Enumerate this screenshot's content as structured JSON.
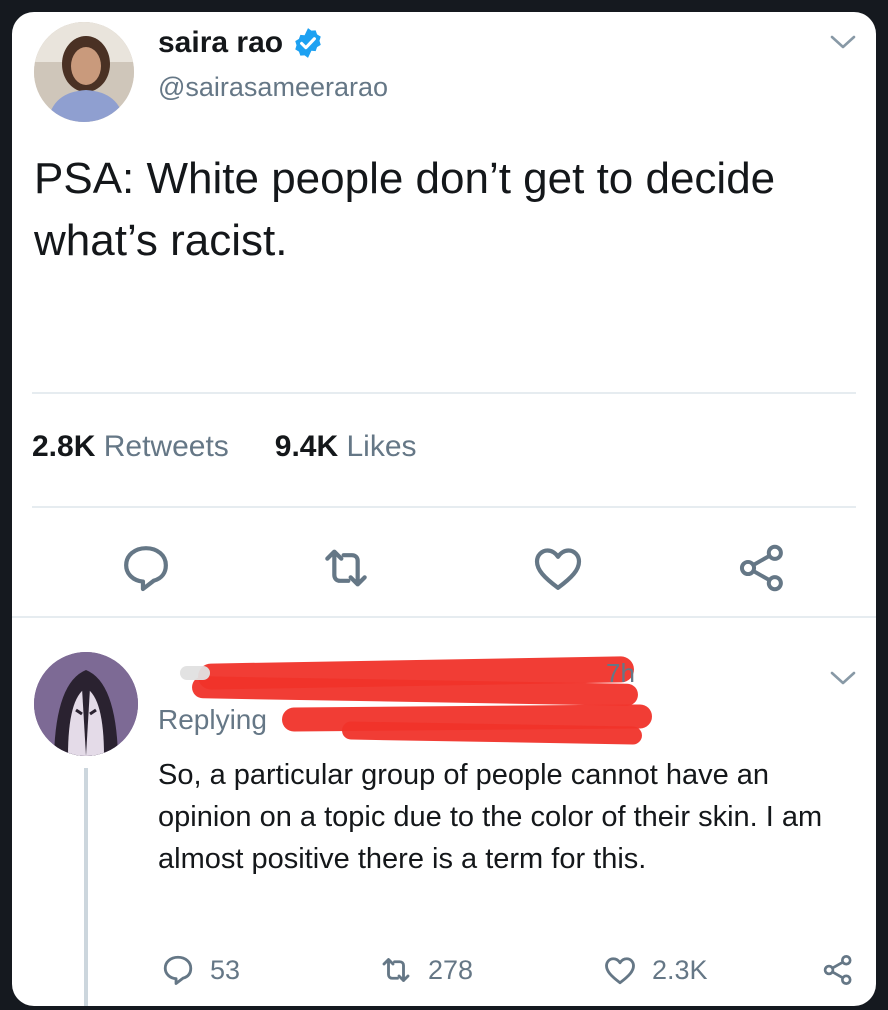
{
  "tweet": {
    "author_name": "saira rao",
    "author_handle": "@sairasameerarao",
    "text": "PSA: White people don’t get to decide what’s racist.",
    "retweets_count": "2.8K",
    "retweets_label": "Retweets",
    "likes_count": "9.4K",
    "likes_label": "Likes"
  },
  "reply": {
    "time": "7h",
    "replying_prefix": "Replying",
    "text": "So, a particular group of people cannot have an opinion on a topic due to the color of their skin. I am almost positive there is a term for this.",
    "reply_count": "53",
    "retweet_count": "278",
    "like_count": "2.3K"
  },
  "colors": {
    "accent": "#1da1f2",
    "secondary_text": "#657786",
    "redaction": "#f0332a",
    "background": "#15191f"
  },
  "icons": [
    "verified-badge-icon",
    "chevron-down-icon",
    "reply-icon",
    "retweet-icon",
    "like-icon",
    "share-icon"
  ]
}
